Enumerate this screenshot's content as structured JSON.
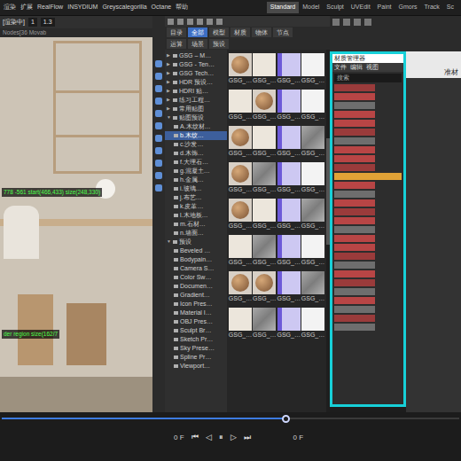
{
  "menu_bar": {
    "items": [
      "渲染",
      "扩展",
      "RealFlow",
      "INSYDIUM",
      "Greyscalegorilla",
      "Octane",
      "帮助"
    ]
  },
  "layouts": [
    {
      "label": "Standard",
      "selected": true
    },
    {
      "label": "Model",
      "selected": false
    },
    {
      "label": "Sculpt",
      "selected": false
    },
    {
      "label": "UVEdit",
      "selected": false
    },
    {
      "label": "Paint",
      "selected": false
    },
    {
      "label": "Gmors",
      "selected": false
    },
    {
      "label": "Track",
      "selected": false
    },
    {
      "label": "Sc",
      "selected": false
    }
  ],
  "viewport": {
    "status": "[渲染中]",
    "fields": [
      "1",
      "1.3"
    ],
    "info": "Nodes[36 Movab",
    "overlays": [
      "778 -561 start(466,433) size(248,330)",
      "der region size(162/7"
    ]
  },
  "browser": {
    "tabs": [
      {
        "label": "目录",
        "selected": false
      },
      {
        "label": "全部",
        "selected": true
      },
      {
        "label": "模型",
        "selected": false
      },
      {
        "label": "材质",
        "selected": false
      },
      {
        "label": "物体",
        "selected": false
      },
      {
        "label": "节点",
        "selected": false
      }
    ],
    "tabs2": [
      {
        "label": "运算",
        "selected": false
      },
      {
        "label": "场景",
        "selected": false
      },
      {
        "label": "预设",
        "selected": false
      }
    ],
    "tree": [
      {
        "label": "GSG – M…",
        "kind": "group",
        "expanded": false,
        "selected": false
      },
      {
        "label": "GSG - Ten…",
        "kind": "group",
        "expanded": false,
        "selected": false
      },
      {
        "label": "GSG Tech…",
        "kind": "group",
        "expanded": false,
        "selected": false
      },
      {
        "label": "HDR 预设…",
        "kind": "group",
        "expanded": false,
        "selected": false
      },
      {
        "label": "HDRI 贴…",
        "kind": "group",
        "expanded": false,
        "selected": false
      },
      {
        "label": "练习工程…",
        "kind": "group",
        "expanded": false,
        "selected": false
      },
      {
        "label": "常用贴图",
        "kind": "group",
        "expanded": false,
        "selected": false
      },
      {
        "label": "贴图预设",
        "kind": "group",
        "expanded": true,
        "selected": false
      },
      {
        "label": "A.木纹材…",
        "kind": "item",
        "expanded": false,
        "selected": false
      },
      {
        "label": "b.木纹…",
        "kind": "item",
        "expanded": false,
        "selected": true
      },
      {
        "label": "c.沙发…",
        "kind": "item",
        "expanded": false,
        "selected": false
      },
      {
        "label": "d.木饰…",
        "kind": "item",
        "expanded": false,
        "selected": false
      },
      {
        "label": "f.大理石…",
        "kind": "item",
        "expanded": false,
        "selected": false
      },
      {
        "label": "g.混凝土…",
        "kind": "item",
        "expanded": false,
        "selected": false
      },
      {
        "label": "h.金属…",
        "kind": "item",
        "expanded": false,
        "selected": false
      },
      {
        "label": "i.玻璃…",
        "kind": "item",
        "expanded": false,
        "selected": false
      },
      {
        "label": "j.布艺…",
        "kind": "item",
        "expanded": false,
        "selected": false
      },
      {
        "label": "k.皮革…",
        "kind": "item",
        "expanded": false,
        "selected": false
      },
      {
        "label": "l.木地板…",
        "kind": "item",
        "expanded": false,
        "selected": false
      },
      {
        "label": "m.石材…",
        "kind": "item",
        "expanded": false,
        "selected": false
      },
      {
        "label": "n.墙面…",
        "kind": "item",
        "expanded": false,
        "selected": false
      },
      {
        "label": "预设",
        "kind": "group",
        "expanded": true,
        "selected": false
      },
      {
        "label": "Beveled …",
        "kind": "item",
        "expanded": false,
        "selected": false
      },
      {
        "label": "Bodypain…",
        "kind": "item",
        "expanded": false,
        "selected": false
      },
      {
        "label": "Camera S…",
        "kind": "item",
        "expanded": false,
        "selected": false
      },
      {
        "label": "Color Sw…",
        "kind": "item",
        "expanded": false,
        "selected": false
      },
      {
        "label": "Documen…",
        "kind": "item",
        "expanded": false,
        "selected": false
      },
      {
        "label": "Gradient…",
        "kind": "item",
        "expanded": false,
        "selected": false
      },
      {
        "label": "Icon Pres…",
        "kind": "item",
        "expanded": false,
        "selected": false
      },
      {
        "label": "Material I…",
        "kind": "item",
        "expanded": false,
        "selected": false
      },
      {
        "label": "OBJ Pres…",
        "kind": "item",
        "expanded": false,
        "selected": false
      },
      {
        "label": "Sculpt Br…",
        "kind": "item",
        "expanded": false,
        "selected": false
      },
      {
        "label": "Sketch Pr…",
        "kind": "item",
        "expanded": false,
        "selected": false
      },
      {
        "label": "Sky Prese…",
        "kind": "item",
        "expanded": false,
        "selected": false
      },
      {
        "label": "Spline Pr…",
        "kind": "item",
        "expanded": false,
        "selected": false
      },
      {
        "label": "Viewport…",
        "kind": "item",
        "expanded": false,
        "selected": false
      }
    ],
    "grid": [
      [
        {
          "label": "GSG_…",
          "kind": "sphere"
        },
        {
          "label": "GSG_…",
          "kind": "light"
        },
        {
          "label": "GSG_…",
          "kind": "purple"
        },
        {
          "label": "GSG_…",
          "kind": "white"
        }
      ],
      [
        {
          "label": "GSG_…",
          "kind": "light"
        },
        {
          "label": "GSG_…",
          "kind": "sphere"
        },
        {
          "label": "GSG_…",
          "kind": "purple"
        },
        {
          "label": "GSG_…",
          "kind": "white"
        }
      ],
      [
        {
          "label": "GSG_…",
          "kind": "sphere"
        },
        {
          "label": "GSG_…",
          "kind": "light"
        },
        {
          "label": "GSG_…",
          "kind": "purple"
        },
        {
          "label": "GSG_…",
          "kind": "grey"
        }
      ],
      [
        {
          "label": "GSG_…",
          "kind": "sphere"
        },
        {
          "label": "GSG_…",
          "kind": "grey"
        },
        {
          "label": "GSG_…",
          "kind": "purple"
        },
        {
          "label": "GSG_…",
          "kind": "white"
        }
      ],
      [
        {
          "label": "GSG_…",
          "kind": "sphere"
        },
        {
          "label": "GSG_…",
          "kind": "light"
        },
        {
          "label": "GSG_…",
          "kind": "purple"
        },
        {
          "label": "GSG_…",
          "kind": "grey"
        }
      ],
      [
        {
          "label": "GSG_…",
          "kind": "light"
        },
        {
          "label": "GSG_…",
          "kind": "grey"
        },
        {
          "label": "GSG_…",
          "kind": "purple"
        },
        {
          "label": "GSG_…",
          "kind": "white"
        }
      ],
      [
        {
          "label": "GSG_…",
          "kind": "sphere"
        },
        {
          "label": "GSG_…",
          "kind": "sphere"
        },
        {
          "label": "GSG_…",
          "kind": "purple"
        },
        {
          "label": "GSG_…",
          "kind": "grey"
        }
      ],
      [
        {
          "label": "GSG_…",
          "kind": "light"
        },
        {
          "label": "GSG_…",
          "kind": "grey"
        },
        {
          "label": "GSG_…",
          "kind": "purple"
        },
        {
          "label": "GSG_…",
          "kind": "white"
        }
      ]
    ]
  },
  "side_window": {
    "title": "材质管理器",
    "menu": [
      "文件",
      "编辑",
      "视图"
    ],
    "search": {
      "placeholder": "搜索"
    },
    "rows": [
      {
        "color": "#9a3b3b",
        "selected": false
      },
      {
        "color": "#b84545",
        "selected": false
      },
      {
        "color": "#6e6e6e",
        "selected": false
      },
      {
        "color": "#b84545",
        "selected": false
      },
      {
        "color": "#b84545",
        "selected": false
      },
      {
        "color": "#9a3b3b",
        "selected": false
      },
      {
        "color": "#6e6e6e",
        "selected": false
      },
      {
        "color": "#b84545",
        "selected": false
      },
      {
        "color": "#b84545",
        "selected": false
      },
      {
        "color": "#9a3b3b",
        "selected": false
      },
      {
        "color": "#e0a236",
        "selected": true
      },
      {
        "color": "#b84545",
        "selected": false
      },
      {
        "color": "#6e6e6e",
        "selected": false
      },
      {
        "color": "#b84545",
        "selected": false
      },
      {
        "color": "#9a3b3b",
        "selected": false
      },
      {
        "color": "#b84545",
        "selected": false
      },
      {
        "color": "#6e6e6e",
        "selected": false
      },
      {
        "color": "#b84545",
        "selected": false
      },
      {
        "color": "#b84545",
        "selected": false
      },
      {
        "color": "#9a3b3b",
        "selected": false
      },
      {
        "color": "#6e6e6e",
        "selected": false
      },
      {
        "color": "#b84545",
        "selected": false
      },
      {
        "color": "#9a3b3b",
        "selected": false
      },
      {
        "color": "#6e6e6e",
        "selected": false
      },
      {
        "color": "#b84545",
        "selected": false
      },
      {
        "color": "#6e6e6e",
        "selected": false
      },
      {
        "color": "#9a3b3b",
        "selected": false
      },
      {
        "color": "#6e6e6e",
        "selected": false
      }
    ]
  },
  "right_panel": {
    "label": "准材"
  },
  "timeline": {
    "level": 0.62,
    "start": "0 F",
    "end": "0 F",
    "buttons": [
      "⏮",
      "◁",
      "⏸",
      "▷",
      "⏭"
    ]
  }
}
